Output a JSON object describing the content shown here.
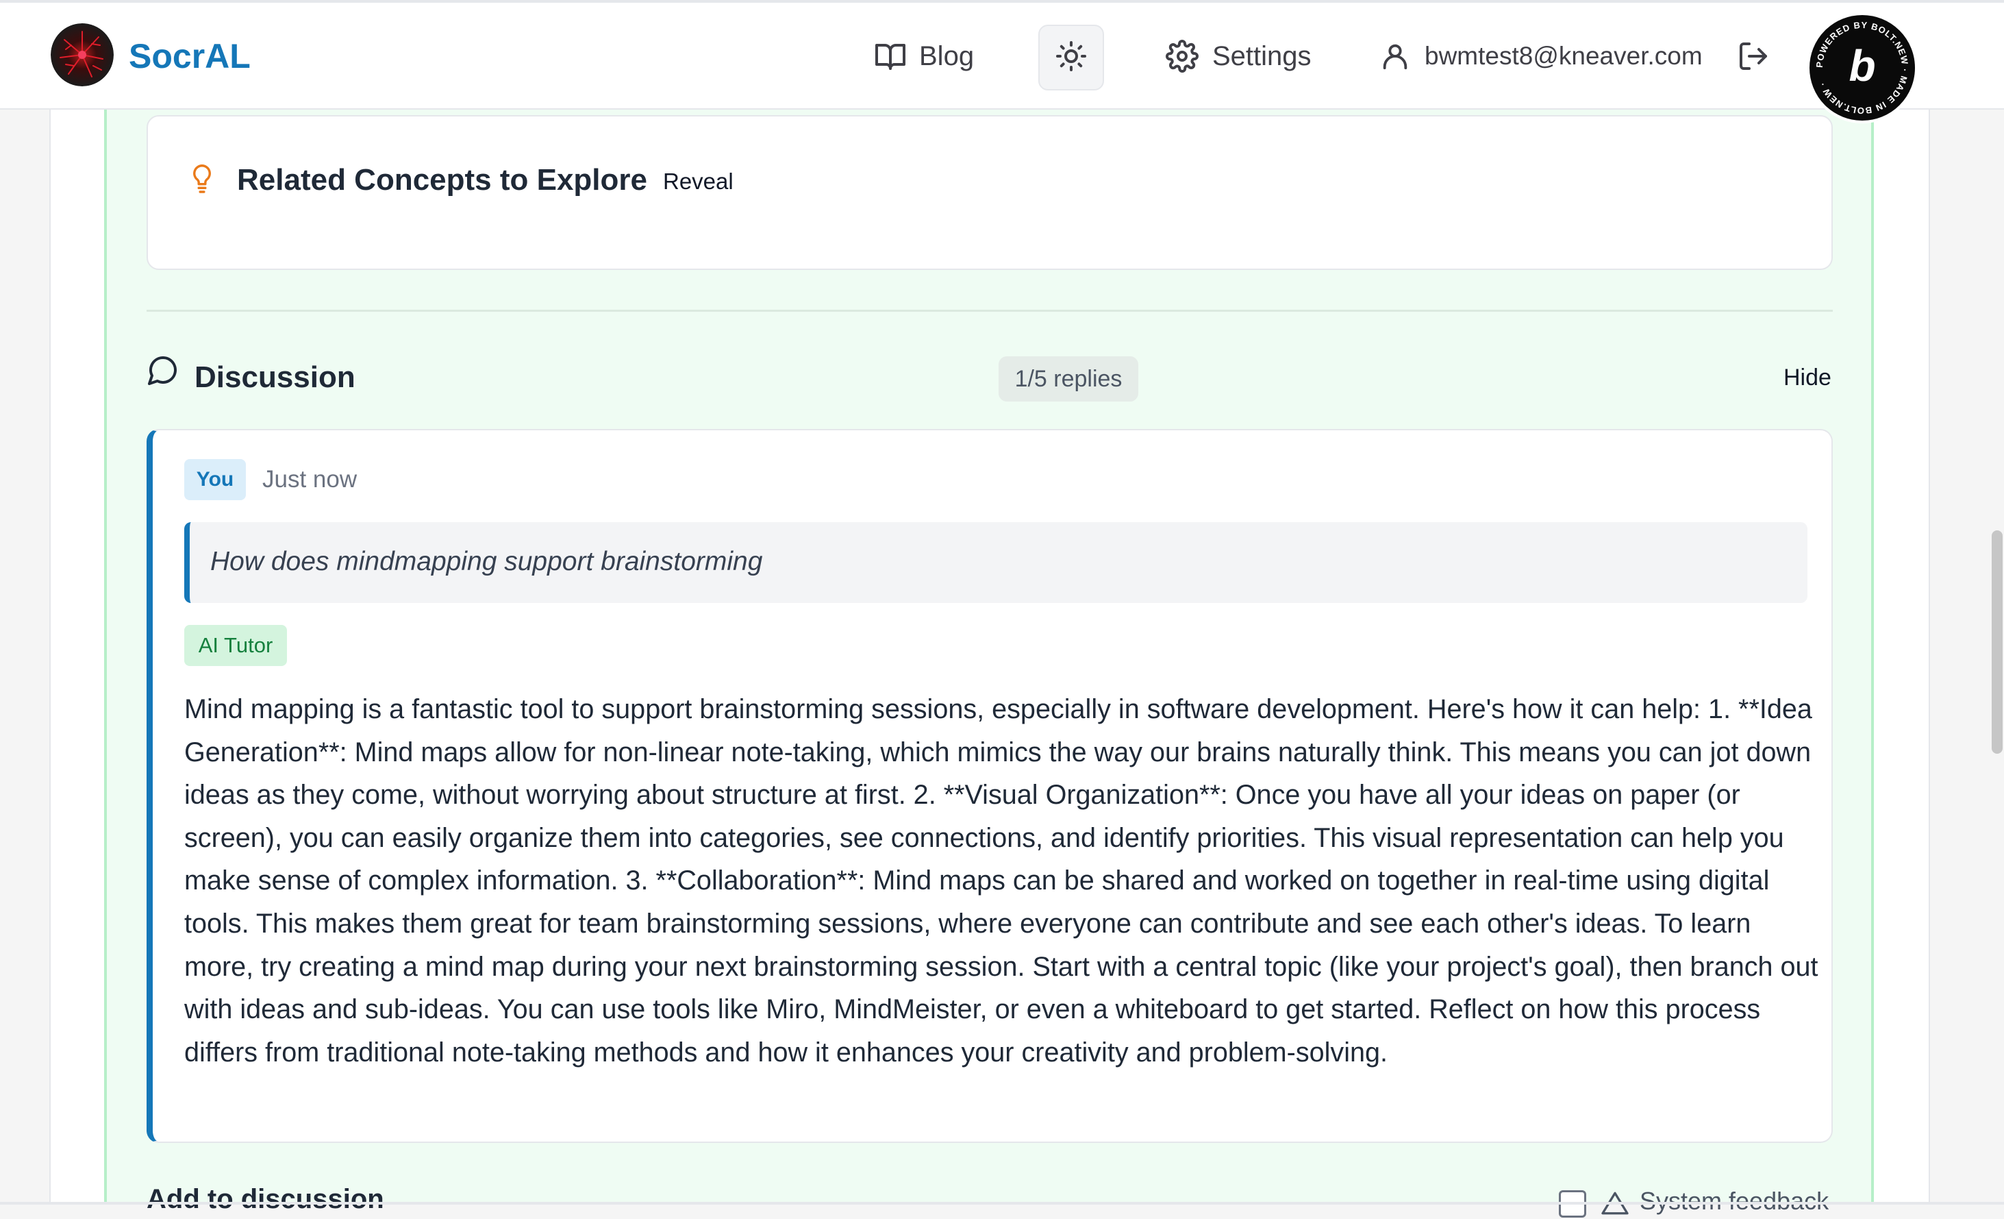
{
  "header": {
    "brand": "SocrAL",
    "nav": {
      "blog": "Blog",
      "settings": "Settings",
      "user_email": "bwmtest8@kneaver.com"
    },
    "bolt_badge": {
      "lettering": "POWERED BY BOLT.NEW MADE IN BOLT.NEW",
      "letter": "b"
    }
  },
  "related": {
    "title": "Related Concepts to Explore",
    "reveal_label": "Reveal"
  },
  "discussion": {
    "title": "Discussion",
    "replies_badge": "1/5 replies",
    "hide_label": "Hide",
    "message": {
      "author_badge": "You",
      "timestamp": "Just now",
      "question": "How does mindmapping support brainstorming",
      "tutor_badge": "AI Tutor",
      "answer": "Mind mapping is a fantastic tool to support brainstorming sessions, especially in software development. Here's how it can help: 1. **Idea Generation**: Mind maps allow for non-linear note-taking, which mimics the way our brains naturally think. This means you can jot down ideas as they come, without worrying about structure at first. 2. **Visual Organization**: Once you have all your ideas on paper (or screen), you can easily organize them into categories, see connections, and identify priorities. This visual representation can help you make sense of complex information. 3. **Collaboration**: Mind maps can be shared and worked on together in real-time using digital tools. This makes them great for team brainstorming sessions, where everyone can contribute and see each other's ideas. To learn more, try creating a mind map during your next brainstorming session. Start with a central topic (like your project's goal), then branch out with ideas and sub-ideas. You can use tools like Miro, MindMeister, or even a whiteboard to get started. Reflect on how this process differs from traditional note-taking methods and how it enhances your creativity and problem-solving."
    }
  },
  "composer": {
    "add_label": "Add to discussion",
    "feedback_label": "System feedback"
  },
  "colors": {
    "accent": "#1577b8",
    "panel_bg": "#effcf3",
    "tutor_green": "#15803d"
  }
}
